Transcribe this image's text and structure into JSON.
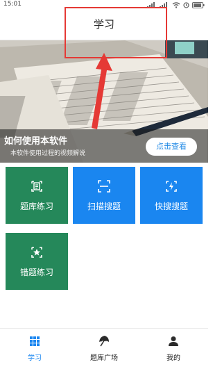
{
  "status_bar": {
    "time": "15:01"
  },
  "header": {
    "title": "学习"
  },
  "banner": {
    "title": "如何使用本软件",
    "subtitle": "本软件使用过程的视频解说",
    "button_label": "点击查看"
  },
  "tiles": [
    {
      "label": "题库练习",
      "icon": "document-icon",
      "color": "#25885a"
    },
    {
      "label": "扫描搜题",
      "icon": "scan-icon",
      "color": "#1a86f0"
    },
    {
      "label": "快搜搜题",
      "icon": "quick-search-icon",
      "color": "#1a86f0"
    },
    {
      "label": "错题练习",
      "icon": "star-badge-icon",
      "color": "#25885a"
    }
  ],
  "bottom_nav": {
    "items": [
      {
        "label": "学习",
        "icon": "grid-icon",
        "active": true
      },
      {
        "label": "题库广场",
        "icon": "umbrella-icon",
        "active": false
      },
      {
        "label": "我的",
        "icon": "person-icon",
        "active": false
      }
    ]
  },
  "colors": {
    "accent": "#1a86f0",
    "green_tile": "#25885a",
    "annotation_red": "#e53935"
  }
}
